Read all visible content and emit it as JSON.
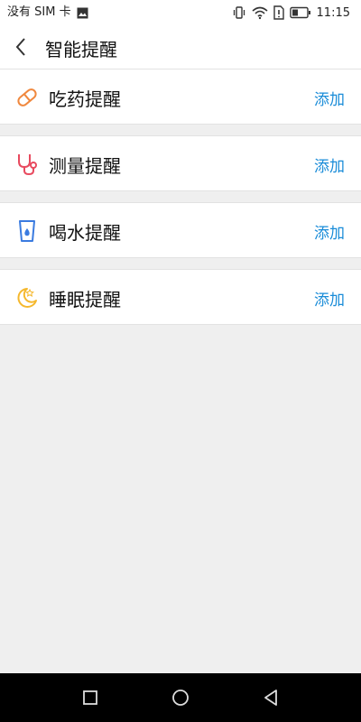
{
  "status_bar": {
    "carrier": "没有 SIM 卡",
    "time": "11:15"
  },
  "header": {
    "title": "智能提醒"
  },
  "reminders": [
    {
      "label": "吃药提醒",
      "action": "添加",
      "icon": "pill-icon",
      "color": "#f0883e"
    },
    {
      "label": "测量提醒",
      "action": "添加",
      "icon": "stethoscope-icon",
      "color": "#e84a5f"
    },
    {
      "label": "喝水提醒",
      "action": "添加",
      "icon": "water-cup-icon",
      "color": "#3a7be0"
    },
    {
      "label": "睡眠提醒",
      "action": "添加",
      "icon": "moon-icon",
      "color": "#f5b82e"
    }
  ],
  "theme": {
    "accent": "#1a8cd8",
    "background": "#efefef"
  }
}
